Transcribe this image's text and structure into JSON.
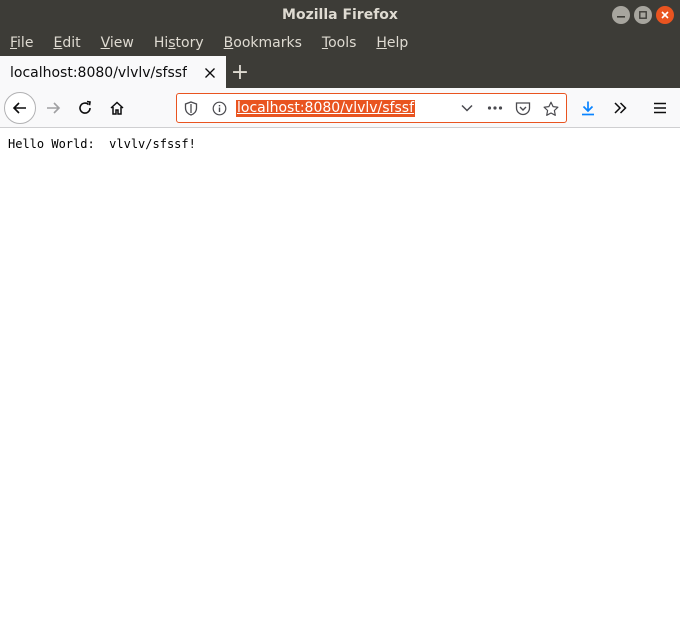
{
  "window": {
    "title": "Mozilla Firefox"
  },
  "menubar": {
    "items": [
      {
        "label_rest": "ile",
        "accel": "F"
      },
      {
        "label_rest": "dit",
        "accel": "E"
      },
      {
        "label_rest": "iew",
        "accel": "V"
      },
      {
        "label_pre": "Hi",
        "accel": "s",
        "label_rest": "tory"
      },
      {
        "accel": "B",
        "label_rest": "ookmarks"
      },
      {
        "accel": "T",
        "label_rest": "ools"
      },
      {
        "accel": "H",
        "label_rest": "elp"
      }
    ]
  },
  "tabs": {
    "active": {
      "title": "localhost:8080/vlvlv/sfssf"
    },
    "new_tab_symbol": "+"
  },
  "urlbar": {
    "url": "localhost:8080/vlvlv/sfssf"
  },
  "page": {
    "text": "Hello World:  vlvlv/sfssf!"
  },
  "colors": {
    "accent": "#e95420",
    "titlebar": "#3d3c37",
    "toolbar": "#f9f9fa",
    "download_icon": "#0a84ff"
  }
}
